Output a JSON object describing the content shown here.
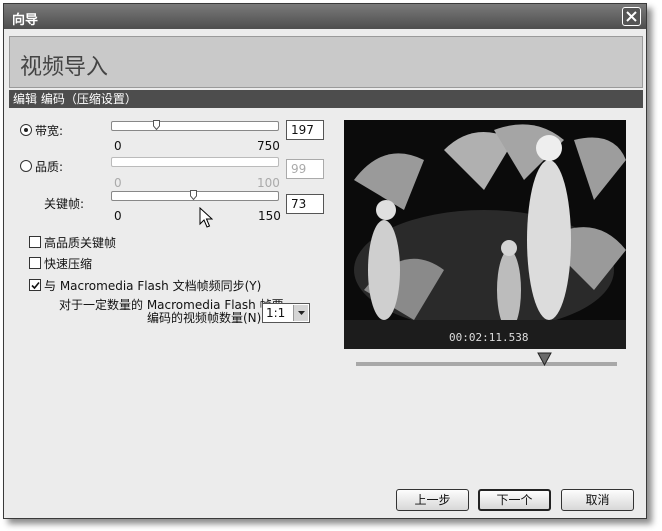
{
  "window": {
    "title": "向导"
  },
  "header": {
    "title": "视频导入"
  },
  "subbar": {
    "breadcrumb": "编辑  编码（压缩设置）"
  },
  "bandwidth": {
    "label": "带宽:",
    "min": "0",
    "max": "750",
    "value": "197",
    "selected": true
  },
  "quality": {
    "label": "品质:",
    "min": "0",
    "max": "100",
    "value": "99",
    "selected": false
  },
  "keyframe": {
    "label": "关键帧:",
    "min": "0",
    "max": "150",
    "value": "73"
  },
  "options": {
    "high_quality_keyframes": {
      "label": "高品质关键帧",
      "checked": false
    },
    "quick_compress": {
      "label": "快速压缩",
      "checked": false
    },
    "sync_flash": {
      "label": "与 Macromedia Flash 文档帧频同步(Y)",
      "checked": true
    }
  },
  "frame_ratio": {
    "label_line1": "对于一定数量的 Macromedia Flash 帧要",
    "label_line2": "编码的视频帧数量(N)",
    "value": "1:1"
  },
  "preview": {
    "timecode": "00:02:11.538"
  },
  "buttons": {
    "back": "上一步",
    "next": "下一个",
    "cancel": "取消"
  }
}
